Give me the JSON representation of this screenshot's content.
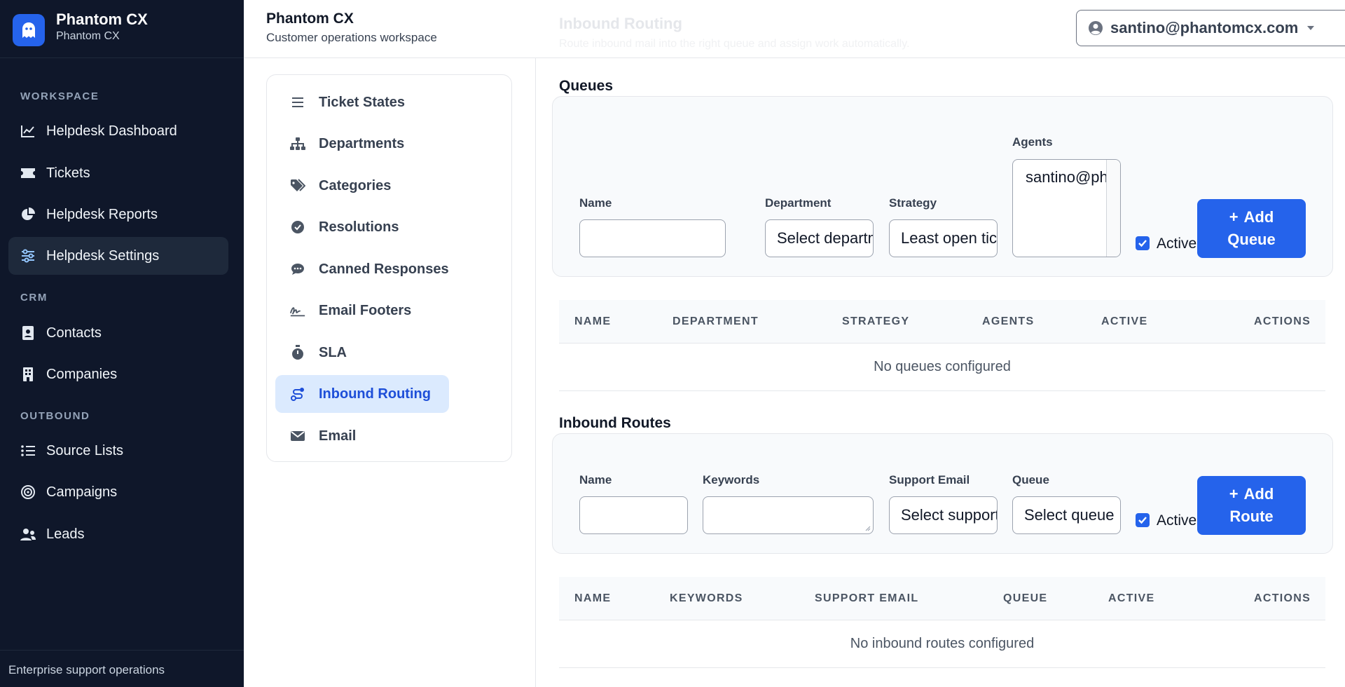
{
  "brand": {
    "name": "Phantom CX",
    "subtitle": "Phantom CX"
  },
  "sidebar": {
    "sections": [
      {
        "label": "WORKSPACE"
      },
      {
        "label": "CRM"
      },
      {
        "label": "OUTBOUND"
      }
    ],
    "items": [
      {
        "label": "Helpdesk Dashboard",
        "icon": "chart-line-icon"
      },
      {
        "label": "Tickets",
        "icon": "ticket-icon"
      },
      {
        "label": "Helpdesk Reports",
        "icon": "pie-chart-icon"
      },
      {
        "label": "Helpdesk Settings",
        "icon": "sliders-icon",
        "active": true
      },
      {
        "label": "Contacts",
        "icon": "address-book-icon"
      },
      {
        "label": "Companies",
        "icon": "building-icon"
      },
      {
        "label": "Source Lists",
        "icon": "list-icon"
      },
      {
        "label": "Campaigns",
        "icon": "target-icon"
      },
      {
        "label": "Leads",
        "icon": "users-icon"
      }
    ],
    "footer": "Enterprise support operations"
  },
  "header": {
    "title": "Phantom CX",
    "subtitle": "Customer operations workspace",
    "ghost_title": "Inbound Routing",
    "ghost_subtitle": "Route inbound mail into the right queue and assign work automatically.",
    "user_email": "santino@phantomcx.com"
  },
  "settings_nav": [
    {
      "label": "Ticket States",
      "icon": "bars-icon"
    },
    {
      "label": "Departments",
      "icon": "sitemap-icon"
    },
    {
      "label": "Categories",
      "icon": "tags-icon"
    },
    {
      "label": "Resolutions",
      "icon": "check-circle-icon"
    },
    {
      "label": "Canned Responses",
      "icon": "comment-dots-icon"
    },
    {
      "label": "Email Footers",
      "icon": "signature-icon"
    },
    {
      "label": "SLA",
      "icon": "stopwatch-icon"
    },
    {
      "label": "Inbound Routing",
      "icon": "route-icon",
      "active": true
    },
    {
      "label": "Email",
      "icon": "envelope-icon"
    }
  ],
  "queues": {
    "title": "Queues",
    "form": {
      "name_label": "Name",
      "department_label": "Department",
      "department_value": "Select department",
      "strategy_label": "Strategy",
      "strategy_value": "Least open tickets",
      "agents_label": "Agents",
      "agents_option": "santino@phantomcx.com",
      "active_label": "Active",
      "active_checked": true,
      "add_button_line1": "Add",
      "add_button_line2": "Queue"
    },
    "table": {
      "columns": [
        "NAME",
        "DEPARTMENT",
        "STRATEGY",
        "AGENTS",
        "ACTIVE",
        "ACTIONS"
      ],
      "empty": "No queues configured"
    }
  },
  "routes": {
    "title": "Inbound Routes",
    "form": {
      "name_label": "Name",
      "keywords_label": "Keywords",
      "support_email_label": "Support Email",
      "support_email_value": "Select support email",
      "queue_label": "Queue",
      "queue_value": "Select queue",
      "active_label": "Active",
      "active_checked": true,
      "add_button_line1": "Add",
      "add_button_line2": "Route"
    },
    "table": {
      "columns": [
        "NAME",
        "KEYWORDS",
        "SUPPORT EMAIL",
        "QUEUE",
        "ACTIVE",
        "ACTIONS"
      ],
      "empty": "No inbound routes configured"
    }
  },
  "colors": {
    "sidebar_bg": "#0f172a",
    "accent": "#2563eb",
    "active_nav_bg": "#dbeafe"
  }
}
